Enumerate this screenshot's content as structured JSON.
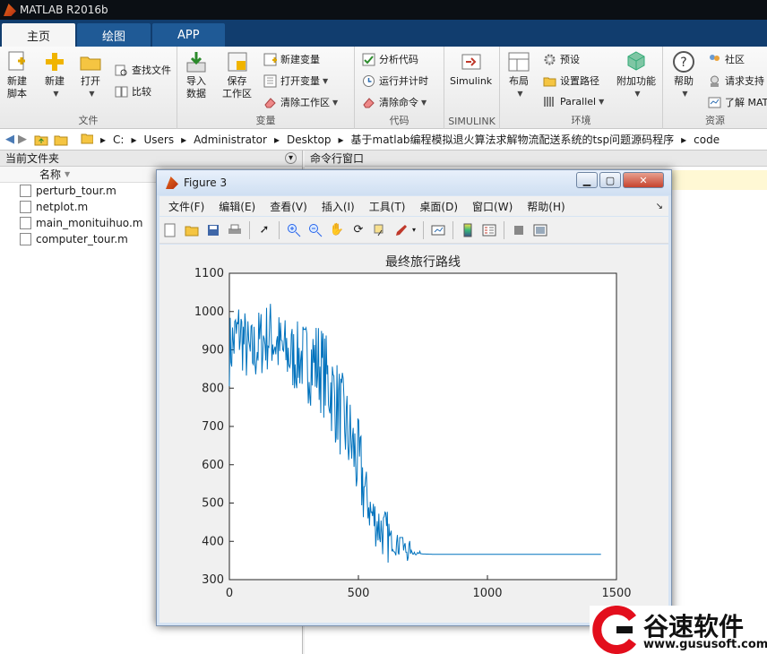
{
  "app": {
    "title": "MATLAB R2016b"
  },
  "tabs": [
    {
      "label": "主页"
    },
    {
      "label": "绘图"
    },
    {
      "label": "APP"
    }
  ],
  "ribbon": {
    "file": {
      "label": "文件",
      "new_script": "新建\n脚本",
      "new": "新建",
      "open": "打开",
      "find_files": "查找文件",
      "compare": "比较"
    },
    "variable": {
      "label": "变量",
      "import": "导入\n数据",
      "save": "保存\n工作区",
      "new_var": "新建变量",
      "open_var": "打开变量",
      "clear_ws": "清除工作区"
    },
    "code": {
      "label": "代码",
      "analyze": "分析代码",
      "run_time": "运行并计时",
      "clear_cmd": "清除命令"
    },
    "simulink": {
      "label": "SIMULINK",
      "btn": "Simulink"
    },
    "env": {
      "label": "环境",
      "layout": "布局",
      "prefs": "预设",
      "set_path": "设置路径",
      "parallel": "Parallel",
      "addons": "附加功能"
    },
    "resources": {
      "label": "资源",
      "help": "帮助",
      "community": "社区",
      "support": "请求支持",
      "learn": "了解 MAT"
    }
  },
  "address": {
    "parts": [
      "C:",
      "Users",
      "Administrator",
      "Desktop",
      "基于matlab编程模拟退火算法求解物流配送系统的tsp问题源码程序",
      "code"
    ]
  },
  "current_folder": {
    "title": "当前文件夹",
    "col_name": "名称",
    "files": [
      "perturb_tour.m",
      "netplot.m",
      "main_monituihuo.m",
      "computer_tour.m"
    ]
  },
  "command_window": {
    "title": "命令行窗口"
  },
  "figure": {
    "title": "Figure 3",
    "menus": [
      "文件(F)",
      "编辑(E)",
      "查看(V)",
      "插入(I)",
      "工具(T)",
      "桌面(D)",
      "窗口(W)",
      "帮助(H)"
    ]
  },
  "chart_data": {
    "type": "line",
    "title": "最终旅行路线",
    "xlabel": "",
    "ylabel": "",
    "xlim": [
      0,
      1500
    ],
    "ylim": [
      300,
      1100
    ],
    "xticks": [
      0,
      500,
      1000,
      1500
    ],
    "yticks": [
      300,
      400,
      500,
      600,
      700,
      800,
      900,
      1000,
      1100
    ],
    "color": "#0072bd",
    "series": [
      {
        "x": [
          0,
          40,
          80,
          120,
          160,
          200,
          250,
          300,
          350,
          400,
          450,
          500,
          550,
          600,
          650,
          700,
          750,
          800,
          1000,
          1200,
          1440
        ],
        "values": [
          900,
          950,
          880,
          920,
          940,
          900,
          880,
          880,
          860,
          790,
          700,
          600,
          470,
          420,
          390,
          372,
          367,
          366,
          366,
          366,
          366
        ]
      }
    ]
  },
  "watermark": {
    "text": "谷速软件",
    "url": "www.gususoft.com"
  }
}
